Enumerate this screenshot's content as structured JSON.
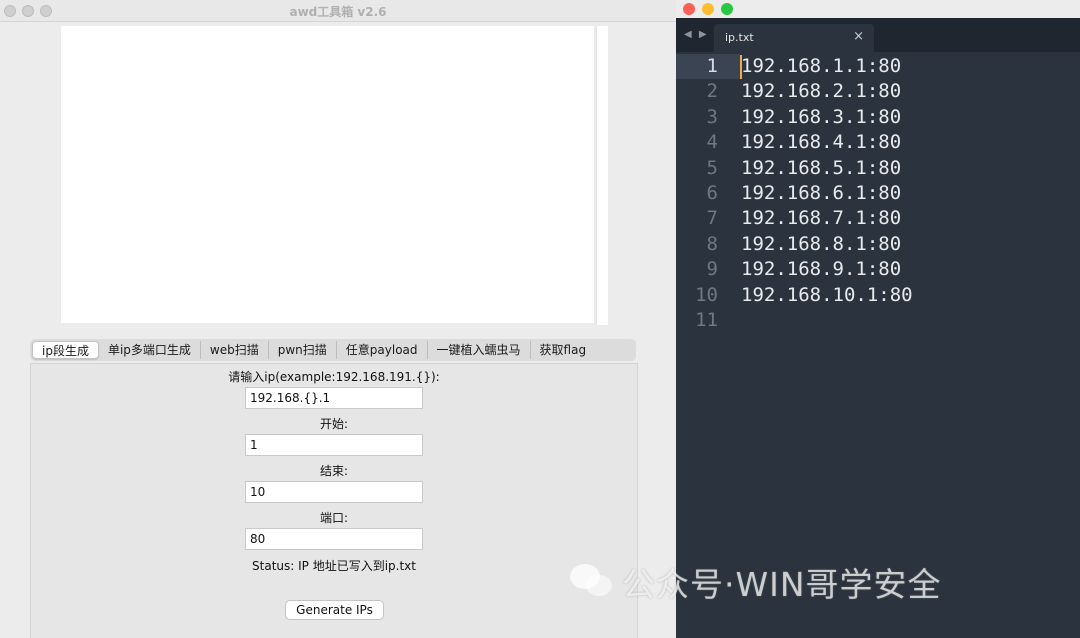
{
  "tool_window": {
    "title": "awd工具箱 v2.6",
    "tabs": [
      {
        "label": "ip段生成",
        "active": true
      },
      {
        "label": "单ip多端口生成",
        "active": false
      },
      {
        "label": "web扫描",
        "active": false
      },
      {
        "label": "pwn扫描",
        "active": false
      },
      {
        "label": "任意payload",
        "active": false
      },
      {
        "label": "一键植入蠕虫马",
        "active": false
      },
      {
        "label": "获取flag",
        "active": false
      }
    ],
    "form": {
      "ip_label": "请输入ip(example:192.168.191.{}):",
      "ip_value": "192.168.{}.1",
      "start_label": "开始:",
      "start_value": "1",
      "end_label": "结束:",
      "end_value": "10",
      "port_label": "端口:",
      "port_value": "80",
      "status_text": "Status: IP 地址已写入到ip.txt",
      "generate_button": "Generate IPs"
    }
  },
  "editor_window": {
    "tab_label": "ip.txt",
    "close_glyph": "×",
    "nav_glyph": "◀ ▶",
    "traffic_lights": [
      "#fe5f57",
      "#febc2e",
      "#28c840"
    ],
    "current_line": 1,
    "lines": [
      "192.168.1.1:80",
      "192.168.2.1:80",
      "192.168.3.1:80",
      "192.168.4.1:80",
      "192.168.5.1:80",
      "192.168.6.1:80",
      "192.168.7.1:80",
      "192.168.8.1:80",
      "192.168.9.1:80",
      "192.168.10.1:80",
      ""
    ]
  },
  "watermark": {
    "text": "公众号·WIN哥学安全"
  }
}
